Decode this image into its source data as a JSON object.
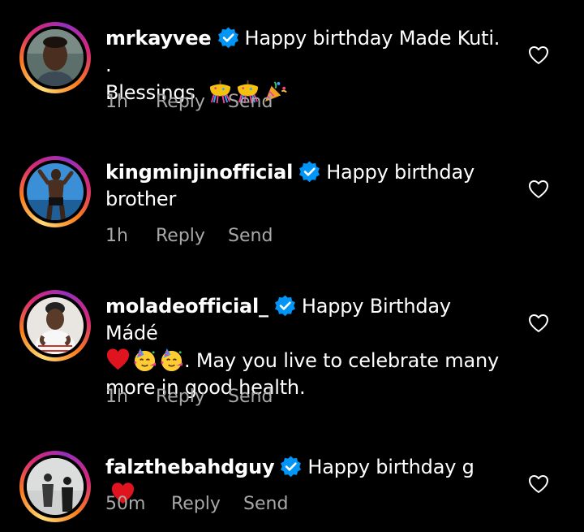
{
  "comments": [
    {
      "username": "mrkayvee",
      "text_line1": "Happy birthday Made Kuti. .",
      "text_line2": "Blessings",
      "emojis": [
        "confetti-ball-icon",
        "confetti-ball-icon",
        "party-popper-icon"
      ],
      "time": "1h",
      "reply": "Reply",
      "send": "Send"
    },
    {
      "username": "kingminjinofficial",
      "text_line1": "Happy birthday",
      "text_line2": "brother",
      "time": "1h",
      "reply": "Reply",
      "send": "Send"
    },
    {
      "username": "moladeofficial_",
      "text_line1": "Happy Birthday Mádé",
      "text_line2": ". May you live to celebrate many",
      "text_line3": "more in good health.",
      "emojis": [
        "red-heart-icon",
        "partying-face-icon",
        "partying-face-icon"
      ],
      "time": "1h",
      "reply": "Reply",
      "send": "Send"
    },
    {
      "username": "falzthebahdguy",
      "text_line1": "Happy birthday g",
      "emojis": [
        "red-heart-icon"
      ],
      "time": "50m",
      "reply": "Reply",
      "send": "Send"
    }
  ],
  "colors": {
    "background": "#000000",
    "text": "#ffffff",
    "meta": "#a8a8a8",
    "verified": "#0095f6",
    "heart": "#e0141e"
  }
}
